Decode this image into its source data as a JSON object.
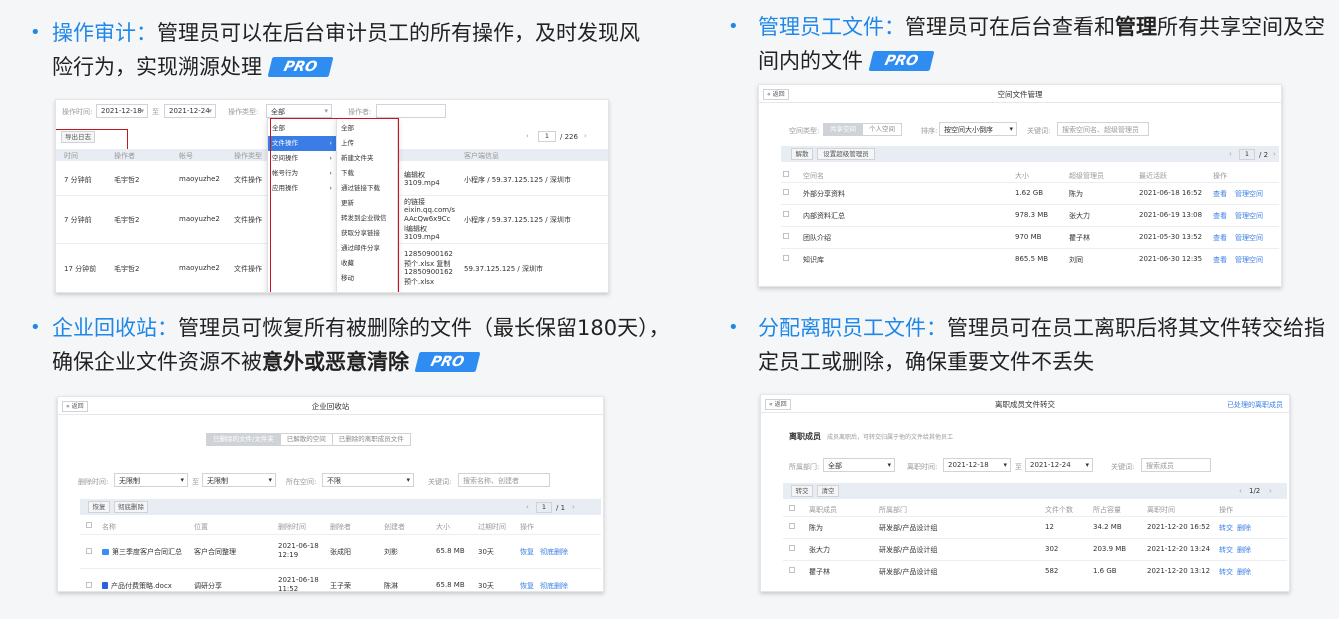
{
  "features": [
    {
      "title": "操作审计",
      "colon": "：",
      "desc_pre": "管理员可以在后台审计员工的所有操作，及时发现风险行为，实现溯源处理",
      "bold": "",
      "desc_post": "",
      "pro": "PRO"
    },
    {
      "title": "管理员工文件",
      "colon": "：",
      "desc_pre": "管理员可在后台查看和",
      "bold": "管理",
      "desc_post": "所有共享空间及空间内的文件",
      "pro": "PRO"
    },
    {
      "title": "企业回收站",
      "colon": "：",
      "desc_pre": "管理员可恢复所有被删除的文件（最长保留180天），确保企业文件资源不被",
      "bold": "意外或恶意清除",
      "desc_post": "",
      "pro": "PRO"
    },
    {
      "title": "分配离职员工文件",
      "colon": "：",
      "desc_pre": "管理员可在员工离职后将其文件转交给指定员工或删除，确保重要文件不丢失",
      "bold": "",
      "desc_post": "",
      "pro": ""
    }
  ],
  "colors": {
    "accent": "#1f87e8",
    "pro_badge": "#2f8df2",
    "highlight": "#c8141e",
    "link": "#3a7de6"
  },
  "audit": {
    "op_time_label": "操作时间:",
    "date_from": "2021-12-18",
    "to": "至",
    "date_to": "2021-12-24",
    "op_type_label": "操作类型:",
    "op_type_value": "全部",
    "operator_label": "操作者:",
    "export_btn": "导出日志",
    "pager_page": "1",
    "pager_total": "/ 226",
    "col_time": "时间",
    "col_op": "操作者",
    "col_account": "帐号",
    "col_type": "操作类型",
    "col_client": "客户端信息",
    "menu1": [
      "全部",
      "文件操作",
      "空间操作",
      "帐号行为",
      "应用操作"
    ],
    "menu2": [
      "全部",
      "上传",
      "新建文件夹",
      "下载",
      "通过链接下载",
      "更新",
      "转发到企业微信",
      "获取分享链接",
      "通过邮件分享",
      "收藏",
      "移动"
    ],
    "rows": [
      {
        "time": "7 分钟前",
        "user": "毛宇哲2",
        "account": "maoyuzhe2",
        "type": "文件操作",
        "detail": [
          "编辑权",
          "3109.mp4"
        ],
        "client": "小程序 / 59.37.125.125 / 深圳市"
      },
      {
        "time": "7 分钟前",
        "user": "毛宇哲2",
        "account": "maoyuzhe2",
        "type": "文件操作",
        "detail": [
          "的链接",
          "eixin.qq.com/s",
          "AAcQw6x9Cc",
          "l编辑权",
          "3109.mp4"
        ],
        "client": "小程序 / 59.37.125.125 / 深圳市"
      },
      {
        "time": "17 分钟前",
        "user": "毛宇哲2",
        "account": "maoyuzhe2",
        "type": "文件操作",
        "detail": [
          "12850900162",
          "预个.xlsx 复制",
          "12850900162",
          "预个.xlsx"
        ],
        "client": "59.37.125.125 / 深圳市"
      }
    ]
  },
  "space": {
    "back": "« 返回",
    "title": "空间文件管理",
    "type_label": "空间类型:",
    "tab_shared": "共享空间",
    "tab_personal": "个人空间",
    "sort_label": "排序:",
    "sort_value": "按空间大小倒序",
    "kw_label": "关键词:",
    "kw_placeholder": "搜索空间名、超级管理员",
    "btn_dismiss": "解散",
    "btn_set_admin": "设置超级管理员",
    "pager_page": "1",
    "pager_total": "/ 2",
    "cols": [
      "空间名",
      "大小",
      "超级管理员",
      "最近活跃",
      "操作"
    ],
    "rows": [
      {
        "name": "外部分享资料",
        "size": "1.62 GB",
        "admin": "陈为",
        "active": "2021-06-18 16:52",
        "view": "查看",
        "manage": "管理空间"
      },
      {
        "name": "内部资料汇总",
        "size": "978.3 MB",
        "admin": "张大力",
        "active": "2021-06-19 13:08",
        "view": "查看",
        "manage": "管理空间"
      },
      {
        "name": "团队介绍",
        "size": "970 MB",
        "admin": "瞿子林",
        "active": "2021-05-30 13:52",
        "view": "查看",
        "manage": "管理空间"
      },
      {
        "name": "知识库",
        "size": "865.5 MB",
        "admin": "刘同",
        "active": "2021-06-30 12:35",
        "view": "查看",
        "manage": "管理空间"
      }
    ]
  },
  "recycle": {
    "back": "« 返回",
    "title": "企业回收站",
    "tabs": [
      "已删除的文件/文件夹",
      "已解散的空间",
      "已删除的离职成员文件"
    ],
    "del_time_label": "删除时间:",
    "unlimited": "无限制",
    "to": "至",
    "space_label": "所在空间:",
    "space_value": "不限",
    "kw_label": "关键词:",
    "kw_placeholder": "搜索名称、创建者",
    "btn_restore": "恢复",
    "btn_purge": "彻底删除",
    "pager_page": "1",
    "pager_total": "/ 1",
    "cols": [
      "名称",
      "位置",
      "删除时间",
      "删除者",
      "创建者",
      "大小",
      "过期时间",
      "操作"
    ],
    "rows": [
      {
        "name": "第三季度客户合同汇总",
        "loc": "客户合同整理",
        "date": "2021-06-18",
        "time": "12:19",
        "deleter": "张成阳",
        "creator": "刘影",
        "size": "65.8 MB",
        "exp": "30天",
        "restore": "恢复",
        "purge": "彻底删除",
        "kind": "folder"
      },
      {
        "name": "产品付费策略.docx",
        "loc": "调研分享",
        "date": "2021-06-18",
        "time": "11:52",
        "deleter": "王子荣",
        "creator": "陈淋",
        "size": "65.8 MB",
        "exp": "30天",
        "restore": "恢复",
        "purge": "彻底删除",
        "kind": "doc"
      }
    ]
  },
  "transfer": {
    "back": "« 返回",
    "title": "离职成员文件转交",
    "handled": "已处理的离职成员",
    "heading": "离职成员",
    "sub": "成员离职后，可转交归属于他的文件给其他员工",
    "dept_label": "所属部门:",
    "dept_value": "全部",
    "leave_label": "离职时间:",
    "date_from": "2021-12-18",
    "to": "至",
    "date_to": "2021-12-24",
    "kw_label": "关键词:",
    "kw_placeholder": "搜索成员",
    "btn_transfer": "转交",
    "btn_clear": "清空",
    "pager": "1/2",
    "cols": [
      "离职成员",
      "所属部门",
      "文件个数",
      "所占容量",
      "离职时间",
      "操作"
    ],
    "rows": [
      {
        "name": "陈为",
        "dept": "研发部/产品设计组",
        "count": "12",
        "size": "34.2 MB",
        "time": "2021-12-20 16:52",
        "a1": "转交",
        "a2": "删除"
      },
      {
        "name": "张大力",
        "dept": "研发部/产品设计组",
        "count": "302",
        "size": "203.9 MB",
        "time": "2021-12-20 13:24",
        "a1": "转交",
        "a2": "删除"
      },
      {
        "name": "瞿子林",
        "dept": "研发部/产品设计组",
        "count": "582",
        "size": "1.6 GB",
        "time": "2021-12-20 13:12",
        "a1": "转交",
        "a2": "删除"
      }
    ]
  }
}
